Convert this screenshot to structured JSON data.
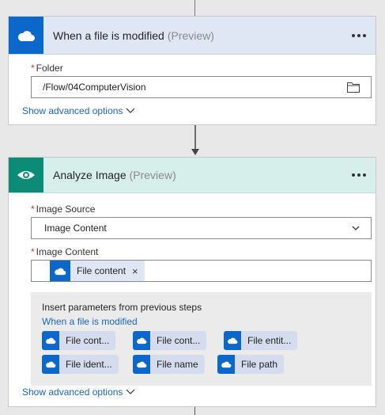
{
  "step1": {
    "title": "When a file is modified",
    "preview": "(Preview)",
    "folder_label": "Folder",
    "folder_value": "/Flow/04ComputerVision",
    "advanced": "Show advanced options"
  },
  "step2": {
    "title": "Analyze Image",
    "preview": "(Preview)",
    "image_source_label": "Image Source",
    "image_source_value": "Image Content",
    "image_content_label": "Image Content",
    "image_content_token": "File content",
    "token_close": "×",
    "advanced": "Show advanced options"
  },
  "params": {
    "title": "Insert parameters from previous steps",
    "source": "When a file is modified",
    "chips": [
      "File cont...",
      "File cont...",
      "File entit...",
      "File ident...",
      "File name",
      "File path"
    ]
  },
  "colors": {
    "onedrive_blue": "#0b67c9",
    "vision_green": "#0c8c77",
    "link_blue": "#1b63c6",
    "required_red": "#d83b01"
  },
  "icons": {
    "onedrive": "cloud-icon",
    "vision": "eye-icon",
    "folder": "folder-icon",
    "chevron": "chevron-down-icon",
    "more": "ellipsis-icon"
  }
}
